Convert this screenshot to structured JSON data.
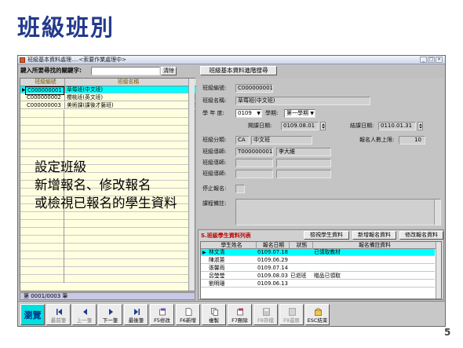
{
  "slide": {
    "title": "班級班別",
    "page_number": "5"
  },
  "window": {
    "title": "班級基本資料處理….<索要作業處理中>"
  },
  "search": {
    "label": "鍵入所要尋找的關鍵字:",
    "value": "",
    "clear_label": "清除"
  },
  "advanced_search_label": "班級基本資料進階搜尋",
  "class_grid": {
    "columns": [
      "班級編號",
      "班級名稱"
    ],
    "rows": [
      {
        "id": "C000000001",
        "name": "草莓班(中文班)"
      },
      {
        "id": "C000000002",
        "name": "櫻桃班(英文班)"
      },
      {
        "id": "C000000003",
        "name": "美術課(課後才藝班)"
      }
    ],
    "record_status": "第 0001/0003 筆"
  },
  "form": {
    "class_no_label": "班級編號:",
    "class_no": "C000000001",
    "class_name_label": "班級名稱:",
    "class_name": "草莓班(中文班)",
    "year_label": "學 年 度:",
    "year": "0109",
    "semester_label": "學期:",
    "semester": "第一學期",
    "start_label": "開課日期:",
    "start_date": "0109.08.01",
    "end_label": "結課日期:",
    "end_date": "0110.01.31",
    "category_label": "班級分類:",
    "category_code": "CA",
    "category_name": "中文班",
    "enroll_limit_label": "報名人數上限:",
    "enroll_limit": "10",
    "teacher_label": "班級導師:",
    "teacher_id": "T000000001",
    "teacher_name": "李大維",
    "stop_label": "停止報名:",
    "notes_label": "課程備註:"
  },
  "student_panel": {
    "title": "S.班級學生資料列表",
    "buttons": [
      "檢視學生資料",
      "新增報名資料",
      "修改報名資料"
    ],
    "columns": [
      "學生姓名",
      "報名日期",
      "狀態",
      "報名備註資料"
    ],
    "rows": [
      {
        "name": "林文清",
        "date": "0109.07.18",
        "status": "",
        "note": "已領取教材"
      },
      {
        "name": "陳淑蕙",
        "date": "0109.06.29",
        "status": "",
        "note": ""
      },
      {
        "name": "張馨雨",
        "date": "0109.07.14",
        "status": "",
        "note": ""
      },
      {
        "name": "呂瑩瑩",
        "date": "0109.08.03",
        "status": "已退班",
        "note": "贈品已領取"
      },
      {
        "name": "劉明珊",
        "date": "0109.06.13",
        "status": "",
        "note": ""
      }
    ]
  },
  "toolbar": [
    {
      "label": "瀏覽",
      "icon": "browse"
    },
    {
      "label": "最前筆",
      "icon": "first-record-icon"
    },
    {
      "label": "上一筆",
      "icon": "prev-record-icon"
    },
    {
      "label": "下一筆",
      "icon": "next-record-icon"
    },
    {
      "label": "最後筆",
      "icon": "last-record-icon"
    },
    {
      "label": "F5修改",
      "icon": "edit-icon"
    },
    {
      "label": "F6新增",
      "icon": "new-icon"
    },
    {
      "label": "複製",
      "icon": "copy-icon"
    },
    {
      "label": "F7刪除",
      "icon": "delete-icon"
    },
    {
      "label": "F8存檔",
      "icon": "save-icon"
    },
    {
      "label": "F9還原",
      "icon": "undo-icon"
    },
    {
      "label": "ESC結束",
      "icon": "exit-icon"
    }
  ],
  "overlay_text": [
    "設定班級",
    "新增報名、修改報名",
    "或檢視已報名的學生資料"
  ],
  "colors": {
    "title": "#233a8c",
    "highlight_row": "#00ffff",
    "grid_bg": "#ffffe0",
    "student_title": "#c00000",
    "browse_btn": "#00e0e0"
  }
}
